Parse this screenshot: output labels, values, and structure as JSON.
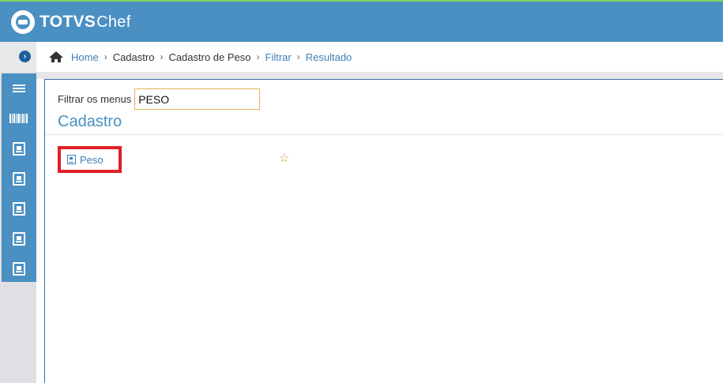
{
  "header": {
    "brand": "TOTVS",
    "product": "Chef"
  },
  "breadcrumb": {
    "home": "Home",
    "items": [
      "Cadastro",
      "Cadastro de Peso",
      "Filtrar",
      "Resultado"
    ],
    "separator": "›"
  },
  "filter": {
    "label": "Filtrar os menus",
    "value": "PESO"
  },
  "section": {
    "title": "Cadastro",
    "items": [
      {
        "label": "Peso",
        "icon": "document-icon",
        "favorite_icon": "☆"
      }
    ]
  },
  "sidebar": {
    "buttons": [
      "menu-icon",
      "barcode-icon",
      "document-icon",
      "document-icon",
      "document-icon",
      "document-icon",
      "document-icon"
    ]
  },
  "colors": {
    "header": "#4a90c2",
    "accent": "#3f7fb5",
    "highlight": "#e01f26",
    "star": "#c9962a"
  }
}
